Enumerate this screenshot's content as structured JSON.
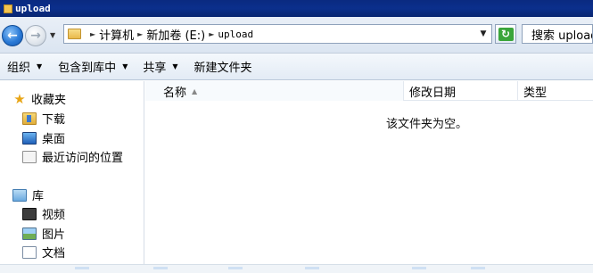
{
  "window": {
    "title": "upload"
  },
  "navigation": {
    "back_icon": "back-arrow-icon",
    "forward_icon": "forward-arrow-icon",
    "address": {
      "folder_icon": "folder-icon",
      "crumbs": [
        "计算机",
        "新加卷 (E:)",
        "upload"
      ]
    },
    "refresh_icon": "refresh-icon",
    "search_placeholder": "搜索 upload"
  },
  "toolbar": {
    "organize": "组织",
    "include_in_library": "包含到库中",
    "share": "共享",
    "new_folder": "新建文件夹"
  },
  "sidebar": {
    "favorites": {
      "label": "收藏夹",
      "items": [
        "下载",
        "桌面",
        "最近访问的位置"
      ]
    },
    "libraries": {
      "label": "库",
      "items": [
        "视频",
        "图片",
        "文档"
      ]
    }
  },
  "columns": [
    "名称",
    "修改日期",
    "类型"
  ],
  "empty_message": "该文件夹为空。",
  "colors": {
    "titlebar": "#0b2f8c",
    "back_button": "#2a7ad6",
    "refresh": "#3aa53a"
  }
}
